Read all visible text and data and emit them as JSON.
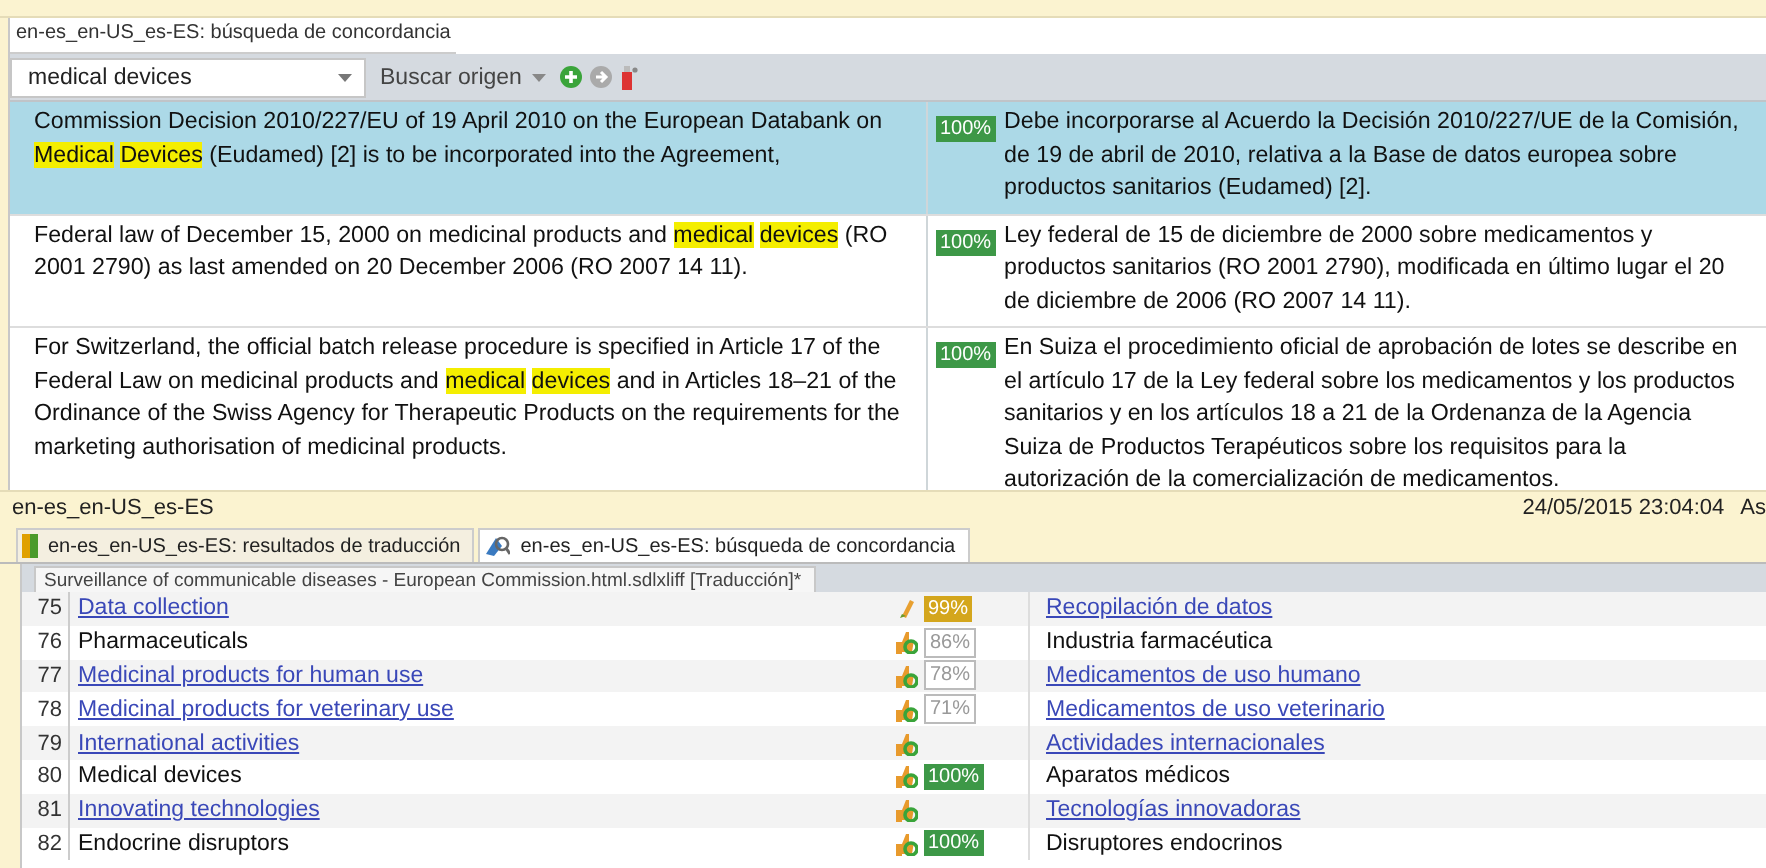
{
  "panel": {
    "title": "en-es_en-US_es-ES: búsqueda de concordancia"
  },
  "toolbar": {
    "search_value": "medical devices",
    "search_button": "Buscar origen"
  },
  "concordance": [
    {
      "selected": true,
      "match": "100%",
      "source": [
        {
          "text": "Commission Decision 2010/227/EU of 19 April 2010 on the European Databank on",
          "hit": false
        },
        {
          "text": "Medical",
          "hit": true
        },
        {
          "text": "Devices",
          "hit": true
        },
        {
          "text": "(Eudamed) [2] is to be incorporated into the Agreement,",
          "hit": false
        }
      ],
      "target": "Debe incorporarse al Acuerdo la Decisión 2010/227/UE de la Comisión, de 19 de abril de 2010, relativa a la Base de datos europea sobre productos sanitarios (Eudamed) [2]."
    },
    {
      "selected": false,
      "match": "100%",
      "source": [
        {
          "text": "Federal law of December 15, 2000 on medicinal products and",
          "hit": false
        },
        {
          "text": "medical",
          "hit": true
        },
        {
          "text": "devices",
          "hit": true
        },
        {
          "text": "(RO 2001 2790) as last amended on 20 December 2006 (RO 2007 14 11).",
          "hit": false
        }
      ],
      "target": "Ley federal de 15 de diciembre de 2000 sobre medicamentos y productos sanitarios (RO 2001 2790), modificada en último lugar el 20 de diciembre de 2006 (RO 2007 14 11)."
    },
    {
      "selected": false,
      "match": "100%",
      "source": [
        {
          "text": "For Switzerland, the official batch release procedure is specified in Article 17 of the Federal Law on medicinal products and",
          "hit": false
        },
        {
          "text": "medical",
          "hit": true
        },
        {
          "text": "devices",
          "hit": true
        },
        {
          "text": "and in Articles 18–21 of the Ordinance of the Swiss Agency for Therapeutic Products on the requirements for the marketing authorisation of medicinal products.",
          "hit": false
        }
      ],
      "target": "En Suiza el procedimiento oficial de aprobación de lotes se describe en el artículo 17 de la Ley federal sobre los medicamentos y los productos sanitarios y en los artículos 18 a 21 de la Ordenanza de la Agencia Suiza de Productos Terapéuticos sobre los requisitos para la autorización de la comercialización de medicamentos."
    }
  ],
  "status_bar": {
    "left": "en-es_en-US_es-ES",
    "date": "24/05/2015 23:04:04",
    "right": "As"
  },
  "tabs": [
    {
      "label": "en-es_en-US_es-ES: resultados de traducción",
      "kind": "results",
      "selected": false
    },
    {
      "label": "en-es_en-US_es-ES: búsqueda de concordancia",
      "kind": "concordance",
      "selected": true
    }
  ],
  "document": {
    "tab": "Surveillance of communicable diseases - European Commission.html.sdlxliff [Traducción]*"
  },
  "segments": [
    {
      "number": "75",
      "source": "Data collection",
      "link": true,
      "confirmed": false,
      "kind": "context",
      "match": "99%",
      "target": "Recopilación de datos"
    },
    {
      "number": "76",
      "source": "Pharmaceuticals",
      "link": false,
      "confirmed": true,
      "kind": "fuzzy",
      "match": "86%",
      "target": "Industria farmacéutica"
    },
    {
      "number": "77",
      "source": "Medicinal products for human use",
      "link": true,
      "confirmed": true,
      "kind": "fuzzy",
      "match": "78%",
      "target": "Medicamentos de uso humano"
    },
    {
      "number": "78",
      "source": "Medicinal products for veterinary use",
      "link": true,
      "confirmed": true,
      "kind": "fuzzy",
      "match": "71%",
      "target": "Medicamentos de uso veterinario"
    },
    {
      "number": "79",
      "source": "International activities",
      "link": true,
      "confirmed": true,
      "kind": "none",
      "target": "Actividades internacionales"
    },
    {
      "number": "80",
      "source": "Medical devices",
      "link": false,
      "confirmed": true,
      "kind": "exact",
      "match": "100%",
      "target": "Aparatos médicos"
    },
    {
      "number": "81",
      "source": "Innovating technologies",
      "link": true,
      "confirmed": true,
      "kind": "none",
      "target": "Tecnologías innovadoras"
    },
    {
      "number": "82",
      "source": "Endocrine disruptors",
      "link": false,
      "confirmed": true,
      "kind": "exact",
      "match": "100%",
      "target": "Disruptores endocrinos"
    }
  ]
}
